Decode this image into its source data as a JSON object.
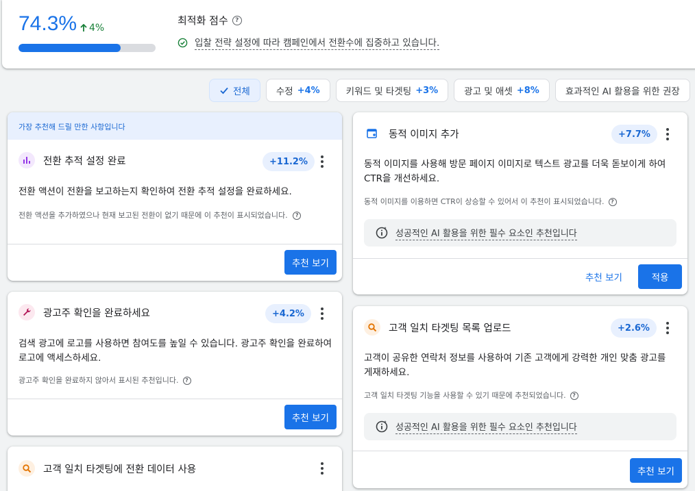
{
  "score": {
    "value": "74.3%",
    "progress": 0.743,
    "delta": "4%",
    "title": "최적화 점수",
    "message": "입찰 전략 설정에 따라 캠페인에서 전환수에 집중하고 있습니다."
  },
  "filters": [
    {
      "label": "전체",
      "delta": "",
      "selected": true
    },
    {
      "label": "수정",
      "delta": "+4%"
    },
    {
      "label": "키워드 및 타겟팅",
      "delta": "+3%"
    },
    {
      "label": "광고 및 애셋",
      "delta": "+8%"
    },
    {
      "label": "효과적인 AI 활용을 위한 권장",
      "delta": ""
    }
  ],
  "left_column": {
    "banner": "가장 추천해 드릴 만한 사항입니다",
    "cards": [
      {
        "title": "전환 추적 설정 완료",
        "badge": "+11.2%",
        "desc": "전환 액션이 전환을 보고하는지 확인하여 전환 추적 설정을 완료하세요.",
        "note": "전환 액션을 추가하였으나 현재 보고된 전환이 없기 때문에 이 추천이 표시되었습니다.",
        "button": "추천 보기",
        "icon": "bar-chart-icon"
      },
      {
        "title": "광고주 확인을 완료하세요",
        "badge": "+4.2%",
        "desc": "검색 광고에 로고를 사용하면 참여도를 높일 수 있습니다. 광고주 확인을 완료하여 로고에 액세스하세요.",
        "note": "광고주 확인을 완료하지 않아서 표시된 추천입니다.",
        "button": "추천 보기",
        "icon": "wrench-icon"
      },
      {
        "title": "고객 일치 타겟팅에 전환 데이터 사용",
        "icon": "search-icon"
      }
    ]
  },
  "right_column": {
    "cards": [
      {
        "title": "동적 이미지 추가",
        "badge": "+7.7%",
        "desc": "동적 이미지를 사용해 방문 페이지 이미지로 텍스트 광고를 더욱 돋보이게 하여 CTR을 개선하세요.",
        "note": "동적 이미지를 이용하면 CTR이 상승할 수 있어서 이 추천이 표시되었습니다.",
        "ai_note": "성공적인 AI 활용을 위한 필수 요소인 추천입니다",
        "button_text": "추천 보기",
        "button_primary": "적용",
        "icon": "image-add-icon"
      },
      {
        "title": "고객 일치 타겟팅 목록 업로드",
        "badge": "+2.6%",
        "desc": "고객이 공유한 연락처 정보를 사용하여 기존 고객에게 강력한 개인 맞춤 광고를 게재하세요.",
        "note": "고객 일치 타겟팅 기능을 사용할 수 있기 때문에 추천되었습니다.",
        "ai_note": "성공적인 AI 활용을 위한 필수 요소인 추천입니다",
        "button": "추천 보기",
        "icon": "search-icon"
      }
    ]
  },
  "colors": {
    "accent": "#1a73e8",
    "positive": "#188038",
    "banner_bg": "#e8f0fe"
  }
}
